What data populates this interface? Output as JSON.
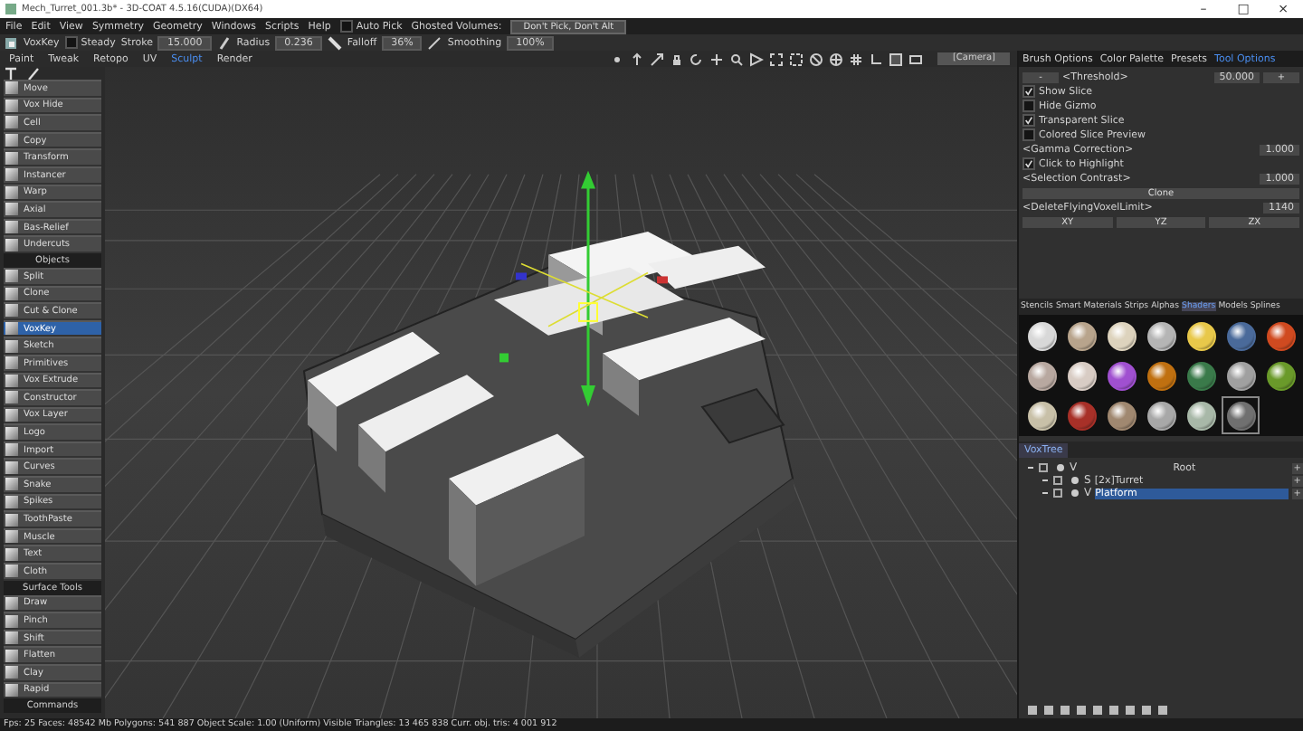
{
  "window": {
    "title": "Mech_Turret_001.3b* - 3D-COAT 4.5.16(CUDA)(DX64)",
    "controls": [
      "–",
      "□",
      "×"
    ]
  },
  "menu": [
    "File",
    "Edit",
    "View",
    "Symmetry",
    "Geometry",
    "Windows",
    "Scripts",
    "Help"
  ],
  "auto_pick": {
    "label": "Auto Pick",
    "checked": false
  },
  "ghosted_volumes": {
    "label": "Ghosted Volumes:",
    "value": "Don't Pick, Don't Alt"
  },
  "toolbar": {
    "tool": "VoxKey",
    "steady": {
      "label": "Steady",
      "checked": false
    },
    "fields": [
      {
        "label": "Stroke",
        "value": "15.000"
      },
      {
        "label": "Radius",
        "value": "0.236"
      },
      {
        "label": "Falloff",
        "value": "36%"
      },
      {
        "label": "Smoothing",
        "value": "100%"
      }
    ]
  },
  "rooms": [
    {
      "label": "Paint",
      "selected": false
    },
    {
      "label": "Tweak",
      "selected": false
    },
    {
      "label": "Retopo",
      "selected": false
    },
    {
      "label": "UV",
      "selected": false
    },
    {
      "label": "Sculpt",
      "selected": true
    },
    {
      "label": "Render",
      "selected": false
    }
  ],
  "viewport": {
    "camera": "[Camera]"
  },
  "tools": [
    {
      "kind": "tool",
      "label": "Move",
      "selected": false
    },
    {
      "kind": "tool",
      "label": "Vox Hide",
      "selected": false
    },
    {
      "kind": "tool",
      "label": "Cell",
      "selected": false
    },
    {
      "kind": "tool",
      "label": "Copy",
      "selected": false
    },
    {
      "kind": "tool",
      "label": "Transform",
      "selected": false
    },
    {
      "kind": "tool",
      "label": "Instancer",
      "selected": false
    },
    {
      "kind": "tool",
      "label": "Warp",
      "selected": false
    },
    {
      "kind": "tool",
      "label": "Axial",
      "selected": false
    },
    {
      "kind": "tool",
      "label": "Bas-Relief",
      "selected": false
    },
    {
      "kind": "tool",
      "label": "Undercuts",
      "selected": false
    },
    {
      "kind": "header",
      "label": "Objects"
    },
    {
      "kind": "tool",
      "label": "Split",
      "selected": false
    },
    {
      "kind": "tool",
      "label": "Clone",
      "selected": false
    },
    {
      "kind": "tool",
      "label": "Cut & Clone",
      "selected": false
    },
    {
      "kind": "tool",
      "label": "VoxKey",
      "selected": true
    },
    {
      "kind": "tool",
      "label": "Sketch",
      "selected": false
    },
    {
      "kind": "tool",
      "label": "Primitives",
      "selected": false
    },
    {
      "kind": "tool",
      "label": "Vox Extrude",
      "selected": false
    },
    {
      "kind": "tool",
      "label": "Constructor",
      "selected": false
    },
    {
      "kind": "tool",
      "label": "Vox Layer",
      "selected": false
    },
    {
      "kind": "tool",
      "label": "Logo",
      "selected": false
    },
    {
      "kind": "tool",
      "label": "Import",
      "selected": false
    },
    {
      "kind": "tool",
      "label": "Curves",
      "selected": false
    },
    {
      "kind": "tool",
      "label": "Snake",
      "selected": false
    },
    {
      "kind": "tool",
      "label": "Spikes",
      "selected": false
    },
    {
      "kind": "tool",
      "label": "ToothPaste",
      "selected": false
    },
    {
      "kind": "tool",
      "label": "Muscle",
      "selected": false
    },
    {
      "kind": "tool",
      "label": "Text",
      "selected": false
    },
    {
      "kind": "tool",
      "label": "Cloth",
      "selected": false
    },
    {
      "kind": "header",
      "label": "Surface Tools"
    },
    {
      "kind": "tool",
      "label": "Draw",
      "selected": false
    },
    {
      "kind": "tool",
      "label": "Pinch",
      "selected": false
    },
    {
      "kind": "tool",
      "label": "Shift",
      "selected": false
    },
    {
      "kind": "tool",
      "label": "Flatten",
      "selected": false
    },
    {
      "kind": "tool",
      "label": "Clay",
      "selected": false
    },
    {
      "kind": "tool",
      "label": "Rapid",
      "selected": false
    },
    {
      "kind": "header",
      "label": "Commands"
    }
  ],
  "panel_tabs": [
    {
      "label": "Brush Options",
      "selected": false
    },
    {
      "label": "Color Palette",
      "selected": false
    },
    {
      "label": "Presets",
      "selected": false
    },
    {
      "label": "Tool Options",
      "selected": true
    }
  ],
  "tool_options": [
    {
      "kind": "spinner",
      "label": "<Threshold>",
      "minus": "-",
      "value": "50.000",
      "plus": "+"
    },
    {
      "kind": "check",
      "label": "Show Slice",
      "checked": true
    },
    {
      "kind": "check",
      "label": "Hide Gizmo",
      "checked": false
    },
    {
      "kind": "check",
      "label": "Transparent Slice",
      "checked": true
    },
    {
      "kind": "check",
      "label": "Colored Slice Preview",
      "checked": false
    },
    {
      "kind": "field",
      "label": "<Gamma Correction>",
      "value": "1.000"
    },
    {
      "kind": "check",
      "label": "Click to Highlight",
      "checked": true
    },
    {
      "kind": "field",
      "label": "<Selection Contrast>",
      "value": "1.000"
    },
    {
      "kind": "button",
      "label": "Clone"
    },
    {
      "kind": "field",
      "label": "<DeleteFlyingVoxelLimit>",
      "value": "1140"
    },
    {
      "kind": "buttons",
      "labels": [
        "XY",
        "YZ",
        "ZX"
      ]
    }
  ],
  "library_tabs": [
    {
      "label": "Stencils",
      "selected": false
    },
    {
      "label": "Smart Materials",
      "selected": false
    },
    {
      "label": "Strips",
      "selected": false
    },
    {
      "label": "Alphas",
      "selected": false
    },
    {
      "label": "Shaders",
      "selected": true
    },
    {
      "label": "Models",
      "selected": false
    },
    {
      "label": "Splines",
      "selected": false
    }
  ],
  "shaders": [
    {
      "color": "#d8d8d8",
      "selected": false
    },
    {
      "color": "#b8a48c",
      "selected": false
    },
    {
      "color": "#ddd3bd",
      "selected": false
    },
    {
      "color": "#b5b5b5",
      "selected": false
    },
    {
      "color": "#e8c84a",
      "selected": false
    },
    {
      "color": "#4a6a9a",
      "selected": false
    },
    {
      "color": "#d04a20",
      "selected": false
    },
    {
      "color": "#b8a8a0",
      "selected": false
    },
    {
      "color": "#d8ccc4",
      "selected": false
    },
    {
      "color": "#a050d0",
      "selected": false
    },
    {
      "color": "#c07010",
      "selected": false
    },
    {
      "color": "#3a7a4a",
      "selected": false
    },
    {
      "color": "#a0a0a0",
      "selected": false
    },
    {
      "color": "#6a9a2a",
      "selected": false
    },
    {
      "color": "#c8c0a8",
      "selected": false
    },
    {
      "color": "#a83028",
      "selected": false
    },
    {
      "color": "#a08870",
      "selected": false
    },
    {
      "color": "#a8a8a8",
      "selected": false
    },
    {
      "color": "#a8b8a8",
      "selected": false
    },
    {
      "color": "#707070",
      "selected": true
    }
  ],
  "voxtree": {
    "tab": "VoxTree",
    "nodes": [
      {
        "type": "V",
        "name": "Root",
        "button": "+",
        "selected": false,
        "children": [
          {
            "type": "S",
            "name": "[2x]Turret",
            "button": "+",
            "selected": false
          },
          {
            "type": "V",
            "name": "Platform",
            "button": "+",
            "selected": true
          }
        ]
      }
    ]
  },
  "status": "Fps: 25   Faces: 48542 Mb Polygons: 541 887 Object Scale: 1.00 (Uniform)  Visible Triangles: 13 465 838  Curr. obj. tris: 4 001 912"
}
